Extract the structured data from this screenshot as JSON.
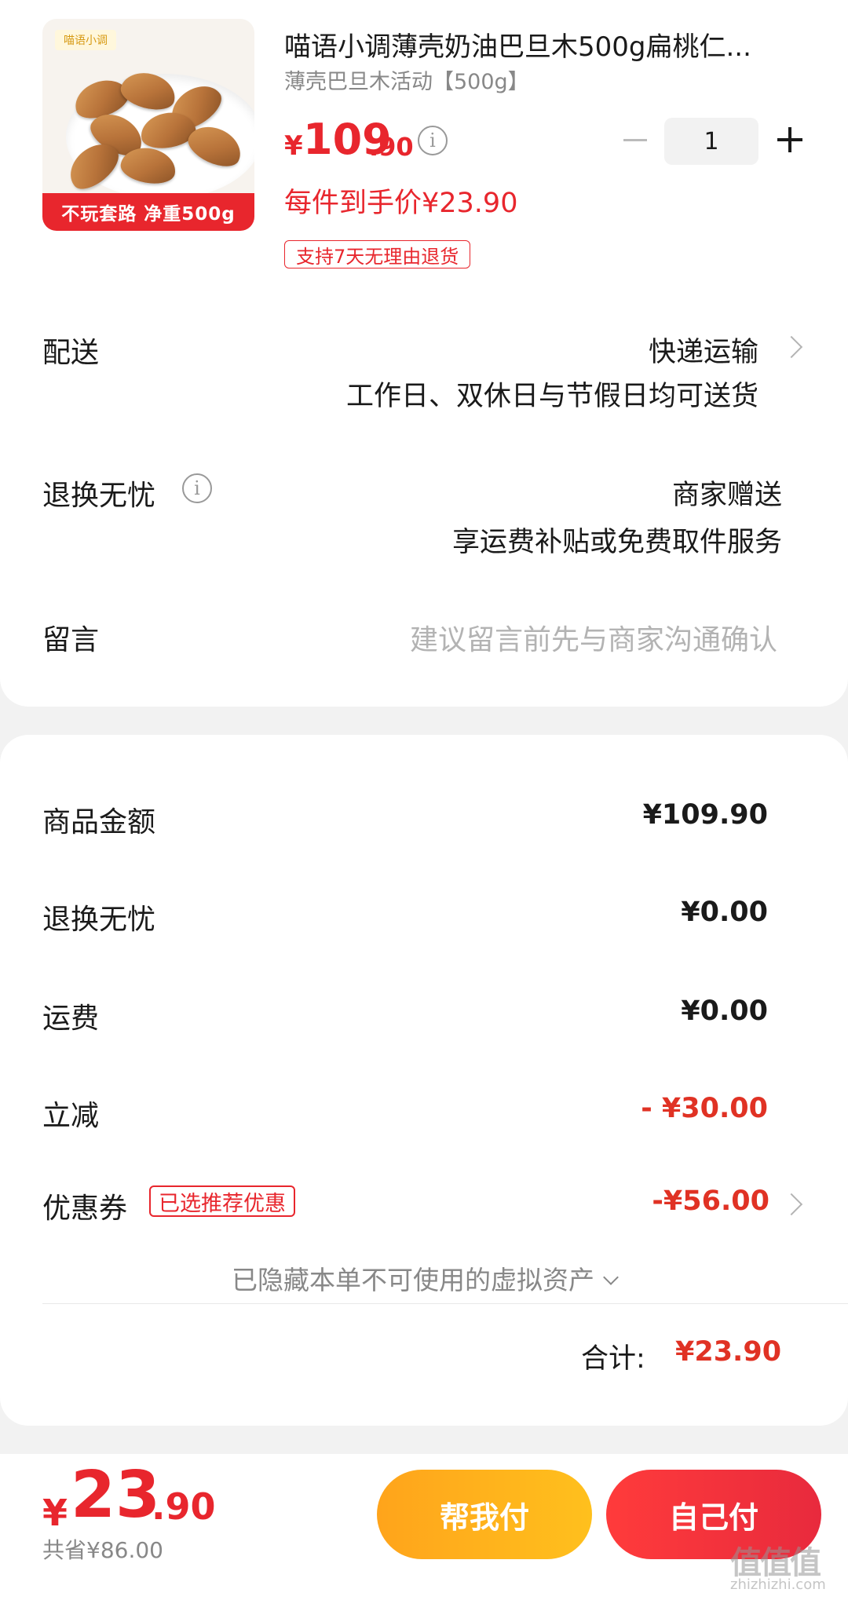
{
  "product": {
    "title": "喵语小调薄壳奶油巴旦木500g扁桃仁...",
    "variant": "薄壳巴旦木活动【500g】",
    "thumb_logo": "喵语小调",
    "thumb_banner": "不玩套路 净重500g",
    "price_symbol": "¥",
    "price_integer": "109",
    "price_decimal": ".90",
    "final_price_text": "每件到手价¥23.90",
    "return_tag": "支持7天无理由退货",
    "quantity": "1"
  },
  "delivery": {
    "label": "配送",
    "method": "快递运输",
    "note": "工作日、双休日与节假日均可送货"
  },
  "return_service": {
    "label": "退换无忧",
    "provider": "商家赠送",
    "note": "享运费补贴或免费取件服务"
  },
  "message": {
    "label": "留言",
    "placeholder": "建议留言前先与商家沟通确认"
  },
  "summary": {
    "rows": [
      {
        "label": "商品金额",
        "value": "¥109.90"
      },
      {
        "label": "退换无忧",
        "value": "¥0.00"
      },
      {
        "label": "运费",
        "value": "¥0.00"
      },
      {
        "label": "立减",
        "value": "- ¥30.00"
      },
      {
        "label": "优惠券",
        "value": "-¥56.00"
      }
    ],
    "coupon_tag": "已选推荐优惠",
    "hidden_note": "已隐藏本单不可使用的虚拟资产",
    "total_label": "合计:",
    "total_value": "¥23.90"
  },
  "bottom_bar": {
    "price_symbol": "¥",
    "price_integer": "23",
    "price_decimal": ".90",
    "saved_text": "共省¥86.00",
    "help_pay_label": "帮我付",
    "self_pay_label": "自己付"
  },
  "watermark": {
    "main": "值值值",
    "sub": "zhizhizhi.com"
  },
  "colors": {
    "accent_red": "#e8262d",
    "accent_orange": "#ffb01c"
  }
}
